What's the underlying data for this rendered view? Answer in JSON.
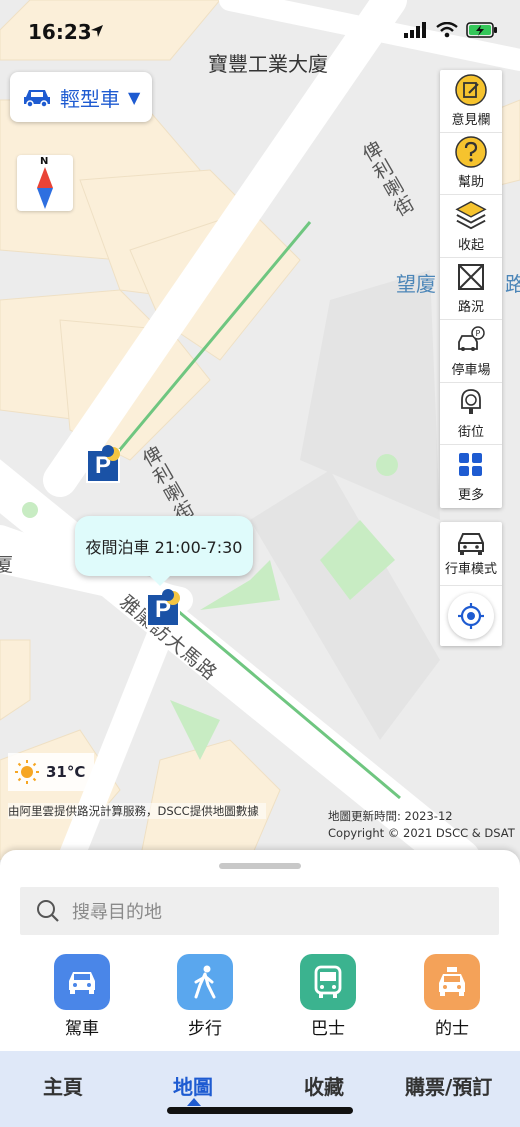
{
  "status_bar": {
    "time": "16:23"
  },
  "map": {
    "labels": {
      "building": "寶豐工業大廈",
      "street_upper": "俾利喇街",
      "street_lower": "俾利喇街",
      "avenue": "雅廉訪大馬路",
      "place": "望廈",
      "place_cut": "路",
      "left_edge": "厦"
    },
    "vehicle_selector": {
      "label": "輕型車",
      "arrow": "▼"
    },
    "compass": {
      "north": "N"
    },
    "tooltip": "夜間泊車 21:00-7:30",
    "weather": {
      "temperature": "31°C"
    },
    "credits": {
      "left": "由阿里雲提供路況計算服務，DSCC提供地圖數據",
      "update": "地圖更新時間: 2023-12",
      "copyright": "Copyright © 2021 DSCC & DSAT"
    }
  },
  "side_panel": {
    "items": [
      {
        "label": "意見欄",
        "icon": "feedback-icon"
      },
      {
        "label": "幫助",
        "icon": "help-icon"
      },
      {
        "label": "收起",
        "icon": "layers-icon"
      },
      {
        "label": "路況",
        "icon": "traffic-icon"
      },
      {
        "label": "停車場",
        "icon": "carpark-icon"
      },
      {
        "label": "街位",
        "icon": "meter-icon"
      },
      {
        "label": "更多",
        "icon": "grid-icon"
      }
    ],
    "drive_mode": "行車模式"
  },
  "bottom_sheet": {
    "search_placeholder": "搜尋目的地",
    "modes": [
      {
        "label": "駕車",
        "icon": "car-icon",
        "color": "#4a86e8"
      },
      {
        "label": "步行",
        "icon": "walk-icon",
        "color": "#5aa7ee"
      },
      {
        "label": "巴士",
        "icon": "bus-icon",
        "color": "#3bb38f"
      },
      {
        "label": "的士",
        "icon": "taxi-icon",
        "color": "#f4a259"
      }
    ]
  },
  "tab_bar": {
    "tabs": [
      "主頁",
      "地圖",
      "收藏",
      "購票/預訂"
    ],
    "active": "地圖"
  },
  "colors": {
    "accent": "#1e5bd1",
    "parking": "#1a52a6",
    "road_green": "#7fd08c"
  }
}
